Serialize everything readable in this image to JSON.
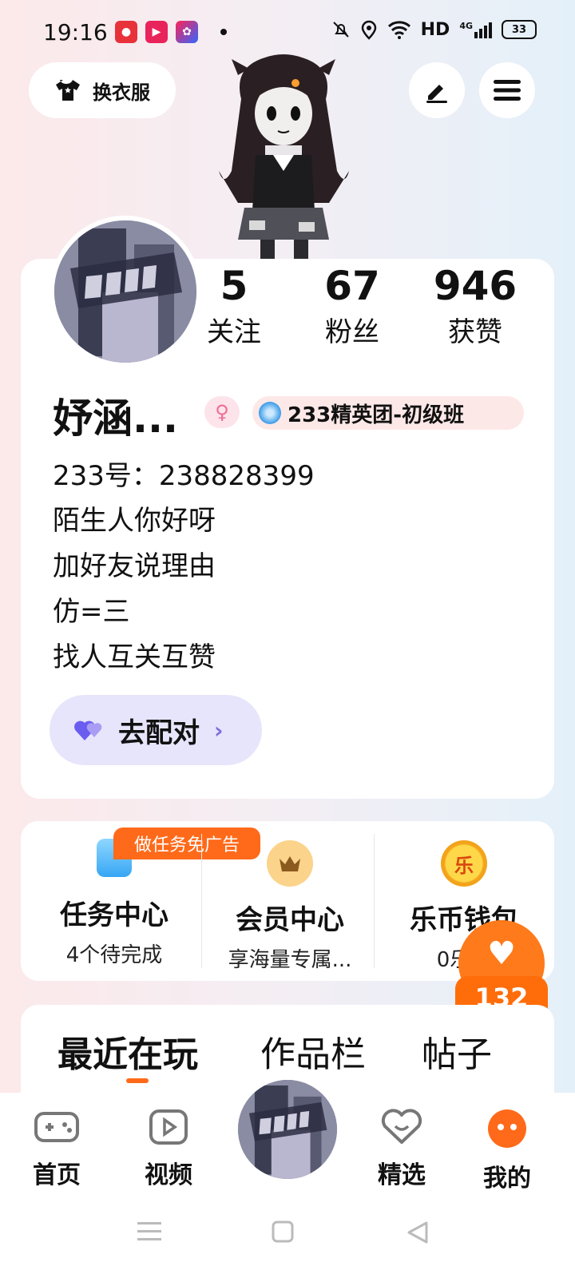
{
  "status_bar": {
    "time": "19:16",
    "network": "HD",
    "signal_label": "4G",
    "battery": "33",
    "icons": [
      "bell-off-icon",
      "location-icon",
      "wifi-icon",
      "signal-icon",
      "battery-icon"
    ]
  },
  "header": {
    "outfit_label": "换衣服",
    "edit_icon": "edit-icon",
    "menu_icon": "menu-icon"
  },
  "profile": {
    "stats": [
      {
        "value": "5",
        "label": "关注"
      },
      {
        "value": "67",
        "label": "粉丝"
      },
      {
        "value": "946",
        "label": "获赞"
      }
    ],
    "username": "妤涵...",
    "gender_icon": "female-icon",
    "rank_badge": "233精英团-初级班",
    "uid": "233号：238828399",
    "bio": [
      "陌生人你好呀",
      "加好友说理由",
      "仿=三",
      "找人互关互赞"
    ],
    "match_label": "去配对"
  },
  "services": [
    {
      "title": "任务中心",
      "subtitle": "4个待完成",
      "icon": "task-icon",
      "tag": "做任务免广告"
    },
    {
      "title": "会员中心",
      "subtitle": "享海量专属...",
      "icon": "crown-icon"
    },
    {
      "title": "乐币钱包",
      "subtitle": "0乐币",
      "icon": "coin-icon",
      "icon_text": "乐"
    }
  ],
  "floating_like": {
    "count": "132"
  },
  "tabs": [
    {
      "label": "最近在玩",
      "active": true
    },
    {
      "label": "作品栏",
      "active": false
    },
    {
      "label": "帖子",
      "active": false
    }
  ],
  "bottom_nav": [
    {
      "label": "首页",
      "icon": "gamepad-icon"
    },
    {
      "label": "视频",
      "icon": "play-icon"
    },
    {
      "label": "精选",
      "icon": "heart-chat-icon"
    },
    {
      "label": "我的",
      "icon": "face-icon",
      "active": true
    }
  ],
  "colors": {
    "accent": "#ff6a1a",
    "match_bg": "#e7e5fb",
    "heart_purple": "#6b5cf0"
  }
}
